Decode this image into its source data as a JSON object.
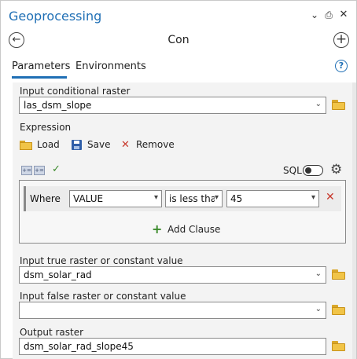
{
  "window": {
    "title": "Geoprocessing",
    "controls": {
      "menu_icon": "⌄",
      "pin_icon": "🖈",
      "close_icon": "✕"
    }
  },
  "tool": {
    "name": "Con",
    "back_icon": "←",
    "add_icon": "+"
  },
  "tabs": [
    {
      "label": "Parameters",
      "active": true
    },
    {
      "label": "Environments",
      "active": false
    }
  ],
  "help_icon": "?",
  "params": {
    "input_conditional": {
      "label": "Input conditional raster",
      "value": "las_dsm_slope"
    },
    "expression": {
      "label": "Expression",
      "load_label": "Load",
      "save_label": "Save",
      "remove_label": "Remove",
      "sql_label": "SQL",
      "sql_enabled": false,
      "clause": {
        "where_label": "Where",
        "field": "VALUE",
        "operator": "is less thar",
        "value": "45"
      },
      "add_clause_label": "Add Clause"
    },
    "input_true": {
      "label": "Input true raster or constant value",
      "value": "dsm_solar_rad"
    },
    "input_false": {
      "label": "Input false raster or constant value",
      "value": ""
    },
    "output": {
      "label": "Output raster",
      "value": "dsm_solar_rad_slope45"
    }
  },
  "colors": {
    "accent": "#1f6fb5",
    "remove": "#c8392d",
    "add": "#3a8a2a",
    "folder": "#f1c447"
  }
}
